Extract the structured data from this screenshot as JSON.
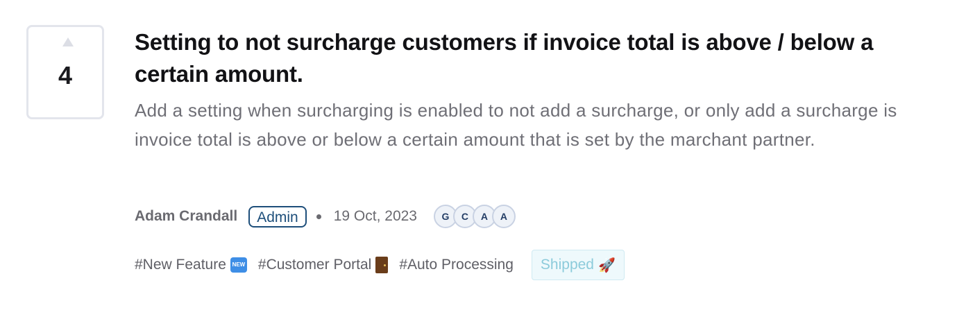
{
  "vote": {
    "count": "4"
  },
  "post": {
    "title": "Setting to not surcharge customers if invoice total is above / below a certain amount.",
    "description": "Add a setting when surcharging is enabled to not add a surcharge, or only add a surcharge is invoice total is above or below a certain amount that is set by the marchant partner."
  },
  "meta": {
    "author": "Adam Crandall",
    "role": "Admin",
    "date": "19 Oct, 2023",
    "avatars": [
      "G",
      "C",
      "A",
      "A"
    ]
  },
  "tags": [
    {
      "label": "#New Feature",
      "icon": "new-badge-icon"
    },
    {
      "label": "#Customer Portal",
      "icon": "door-icon"
    },
    {
      "label": "#Auto Processing",
      "icon": ""
    }
  ],
  "status": {
    "label": "Shipped",
    "icon": "rocket-icon",
    "color": "#8ccbdb",
    "background": "#eef9fc"
  }
}
